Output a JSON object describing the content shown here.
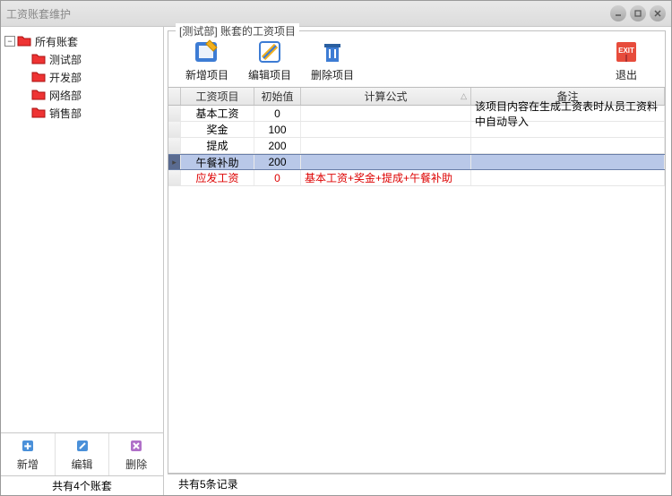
{
  "window": {
    "title": "工资账套维护"
  },
  "tree": {
    "root": "所有账套",
    "items": [
      "测试部",
      "开发部",
      "网络部",
      "销售部"
    ]
  },
  "leftToolbar": {
    "add": "新增",
    "edit": "编辑",
    "delete": "删除"
  },
  "leftStatus": "共有4个账套",
  "group": {
    "label": "[测试部] 账套的工资项目"
  },
  "mainToolbar": {
    "add": "新增项目",
    "edit": "编辑项目",
    "delete": "删除项目",
    "exit": "退出"
  },
  "gridHeaders": {
    "name": "工资项目",
    "init": "初始值",
    "formula": "计算公式",
    "remark": "备注"
  },
  "rows": [
    {
      "name": "基本工资",
      "init": "0",
      "formula": "",
      "remark": "该项目内容在生成工资表时从员工资料中自动导入",
      "sel": false,
      "red": false
    },
    {
      "name": "奖金",
      "init": "100",
      "formula": "",
      "remark": "",
      "sel": false,
      "red": false
    },
    {
      "name": "提成",
      "init": "200",
      "formula": "",
      "remark": "",
      "sel": false,
      "red": false
    },
    {
      "name": "午餐补助",
      "init": "200",
      "formula": "",
      "remark": "",
      "sel": true,
      "red": false
    },
    {
      "name": "应发工资",
      "init": "0",
      "formula": "基本工资+奖金+提成+午餐补助",
      "remark": "",
      "sel": false,
      "red": true
    }
  ],
  "rightStatus": "共有5条记录",
  "icons": {
    "folderRed": "folder-red-icon",
    "minimize": "minimize-icon",
    "maximize": "maximize-icon",
    "close": "close-icon"
  }
}
